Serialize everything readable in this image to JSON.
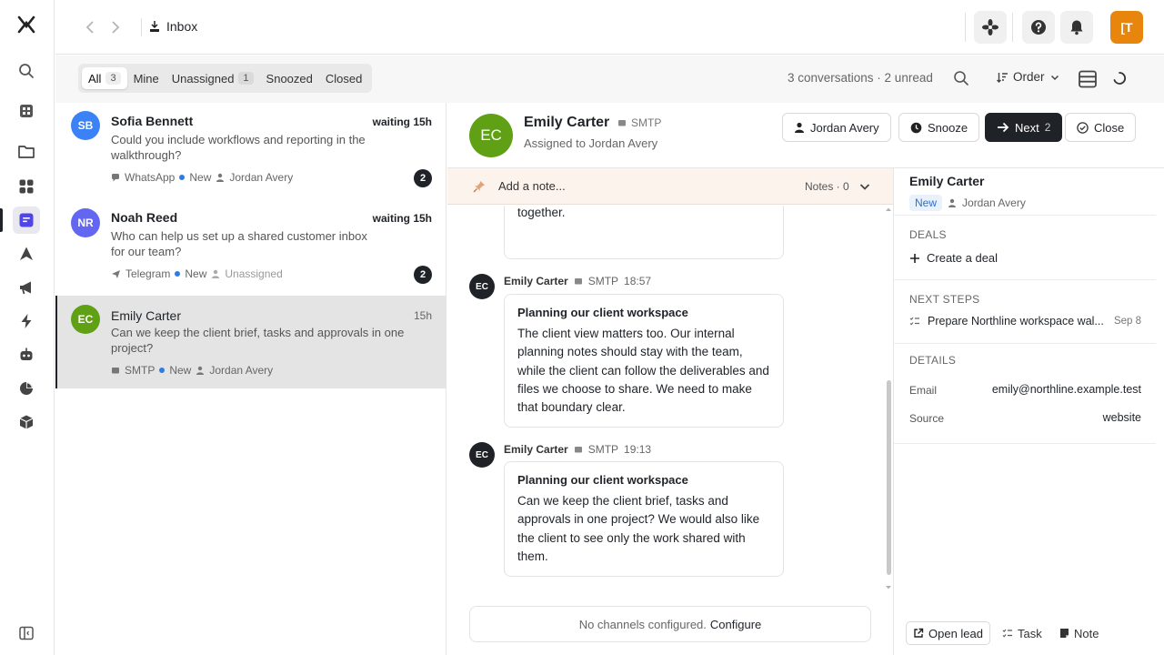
{
  "topbar": {
    "breadcrumb": "Inbox",
    "avatar_initial": "[T",
    "colors": {
      "accent": "#e8850c",
      "brand_purple": "#4f46e5"
    }
  },
  "rail": {
    "items": [
      "logo-icon",
      "search-icon",
      "grid-icon",
      "folder-icon",
      "apps-icon",
      "inbox-icon",
      "navigate-icon",
      "megaphone-icon",
      "bolt-icon",
      "bot-icon",
      "pie-chart-icon",
      "box-icon",
      "sidebar-toggle-icon"
    ]
  },
  "filters": {
    "tabs": [
      {
        "label": "All",
        "count": "3"
      },
      {
        "label": "Mine"
      },
      {
        "label": "Unassigned",
        "count": "1"
      },
      {
        "label": "Snoozed"
      },
      {
        "label": "Closed"
      }
    ],
    "summary": "3 conversations · 2 unread",
    "order_label": "Order"
  },
  "conversations": [
    {
      "initials": "SB",
      "name": "Sofia Bennett",
      "waiting": "waiting 15h",
      "preview": "Could you include workflows and reporting in the walkthrough?",
      "channel": "WhatsApp",
      "status": "New",
      "assignee": "Jordan Avery",
      "unread": "2",
      "color": "#3b82f6"
    },
    {
      "initials": "NR",
      "name": "Noah Reed",
      "waiting": "waiting 15h",
      "preview": "Who can help us set up a shared customer inbox for our team?",
      "channel": "Telegram",
      "status": "New",
      "assignee": "Unassigned",
      "unread": "2",
      "color": "#6366f1"
    },
    {
      "initials": "EC",
      "name": "Emily Carter",
      "waiting": "15h",
      "preview": "Can we keep the client brief, tasks and approvals in one project?",
      "channel": "SMTP",
      "status": "New",
      "assignee": "Jordan Avery",
      "color": "#5fa014"
    }
  ],
  "conversation": {
    "initials": "EC",
    "name": "Emily Carter",
    "channel": "SMTP",
    "assigned": "Assigned to Jordan Avery",
    "buttons": {
      "assignee": "Jordan Avery",
      "snooze": "Snooze",
      "next": "Next",
      "next_count": "2",
      "close": "Close"
    },
    "note_placeholder": "Add a note...",
    "notes_label": "Notes · 0",
    "partial_text": "like to see the customer record, a project with named owners, and the next milestone together.",
    "messages": [
      {
        "initials": "EC",
        "author": "Emily Carter",
        "channel": "SMTP",
        "time": "18:57",
        "subject": "Planning our client workspace",
        "body": "The client view matters too. Our internal planning notes should stay with the team, while the client can follow the deliverables and files we choose to share. We need to make that boundary clear."
      },
      {
        "initials": "EC",
        "author": "Emily Carter",
        "channel": "SMTP",
        "time": "19:13",
        "subject": "Planning our client workspace",
        "body": "Can we keep the client brief, tasks and approvals in one project? We would also like the client to see only the work shared with them."
      }
    ],
    "composer_text": "No channels configured.",
    "composer_link": "Configure"
  },
  "side": {
    "name": "Emily Carter",
    "status": "New",
    "owner": "Jordan Avery",
    "deals_label": "DEALS",
    "create_deal": "Create a deal",
    "next_steps_label": "NEXT STEPS",
    "next_step": "Prepare Northline workspace wal...",
    "next_step_date": "Sep 8",
    "details_label": "DETAILS",
    "details": [
      {
        "key": "Email",
        "value": "emily@northline.example.test"
      },
      {
        "key": "Source",
        "value": "website"
      }
    ],
    "footer": {
      "open_lead": "Open lead",
      "task": "Task",
      "note": "Note"
    }
  }
}
